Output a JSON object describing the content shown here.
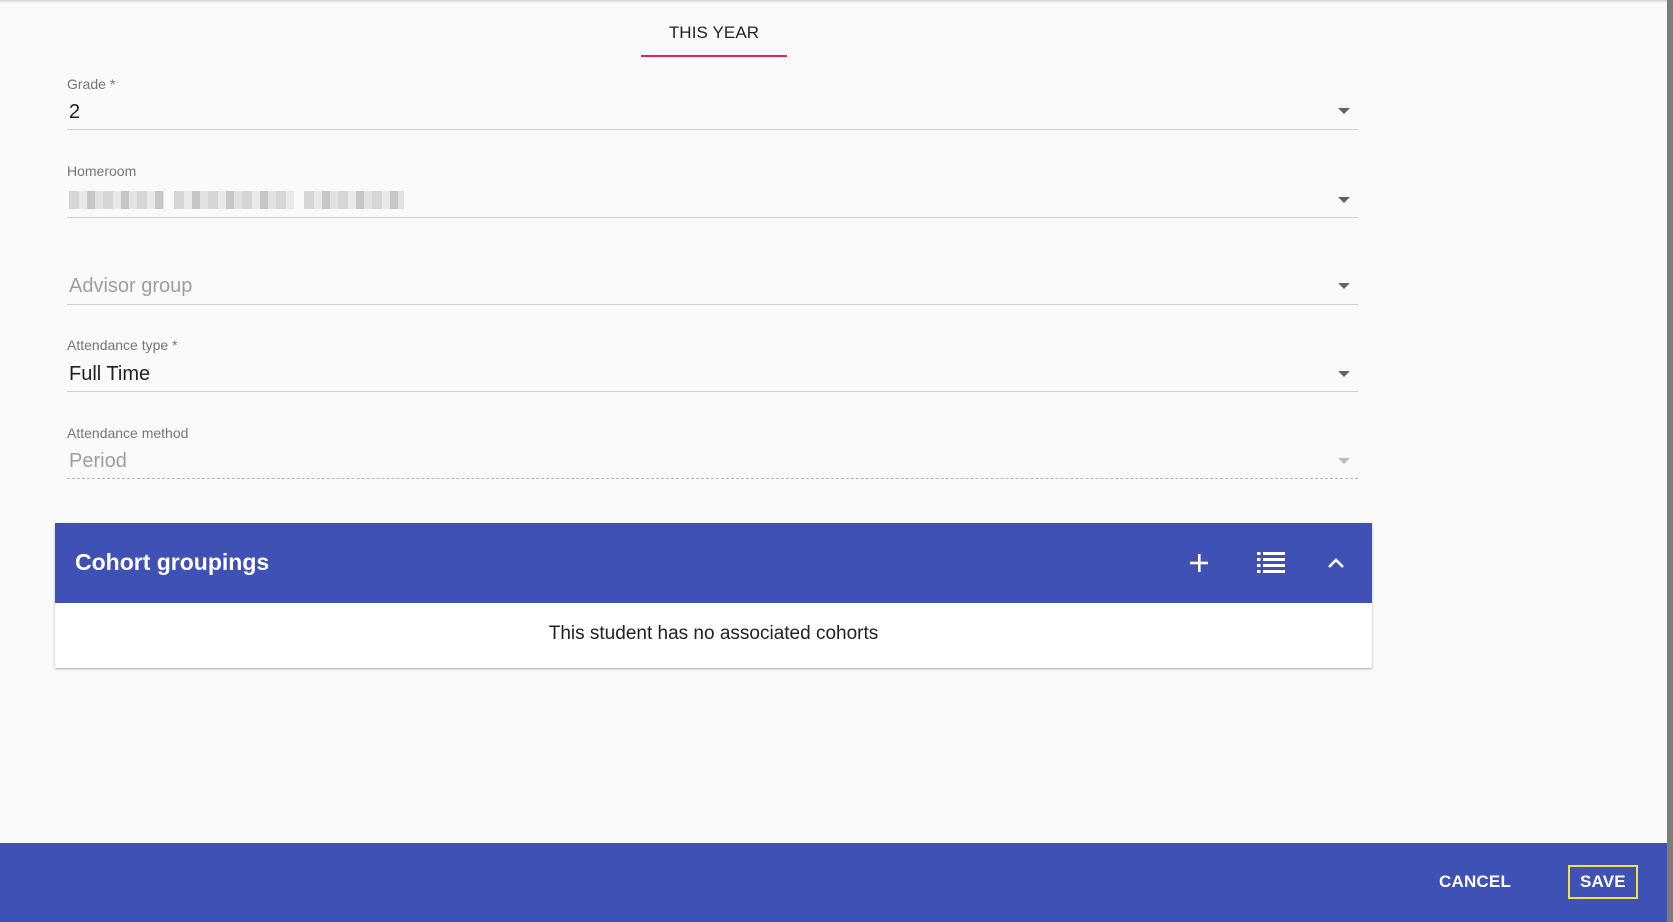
{
  "tabs": [
    {
      "label": "THIS YEAR",
      "active": true
    }
  ],
  "form": {
    "grade": {
      "label": "Grade",
      "required_mark": "*",
      "value": "2"
    },
    "homeroom": {
      "label": "Homeroom",
      "value_obscured": true
    },
    "advisor_group": {
      "placeholder": "Advisor group"
    },
    "attendance_type": {
      "label": "Attendance type",
      "required_mark": "*",
      "value": "Full Time"
    },
    "attendance_method": {
      "label": "Attendance method",
      "value": "Period",
      "disabled": true
    }
  },
  "cohort": {
    "title": "Cohort groupings",
    "empty_message": "This student has no associated cohorts",
    "icons": {
      "add": "plus-icon",
      "list": "list-icon",
      "collapse": "chevron-up-icon"
    }
  },
  "footer": {
    "cancel_label": "CANCEL",
    "save_label": "SAVE"
  },
  "colors": {
    "primary": "#3f51b5",
    "tab_indicator": "#e91e63",
    "save_focus_outline": "#f0e040"
  }
}
